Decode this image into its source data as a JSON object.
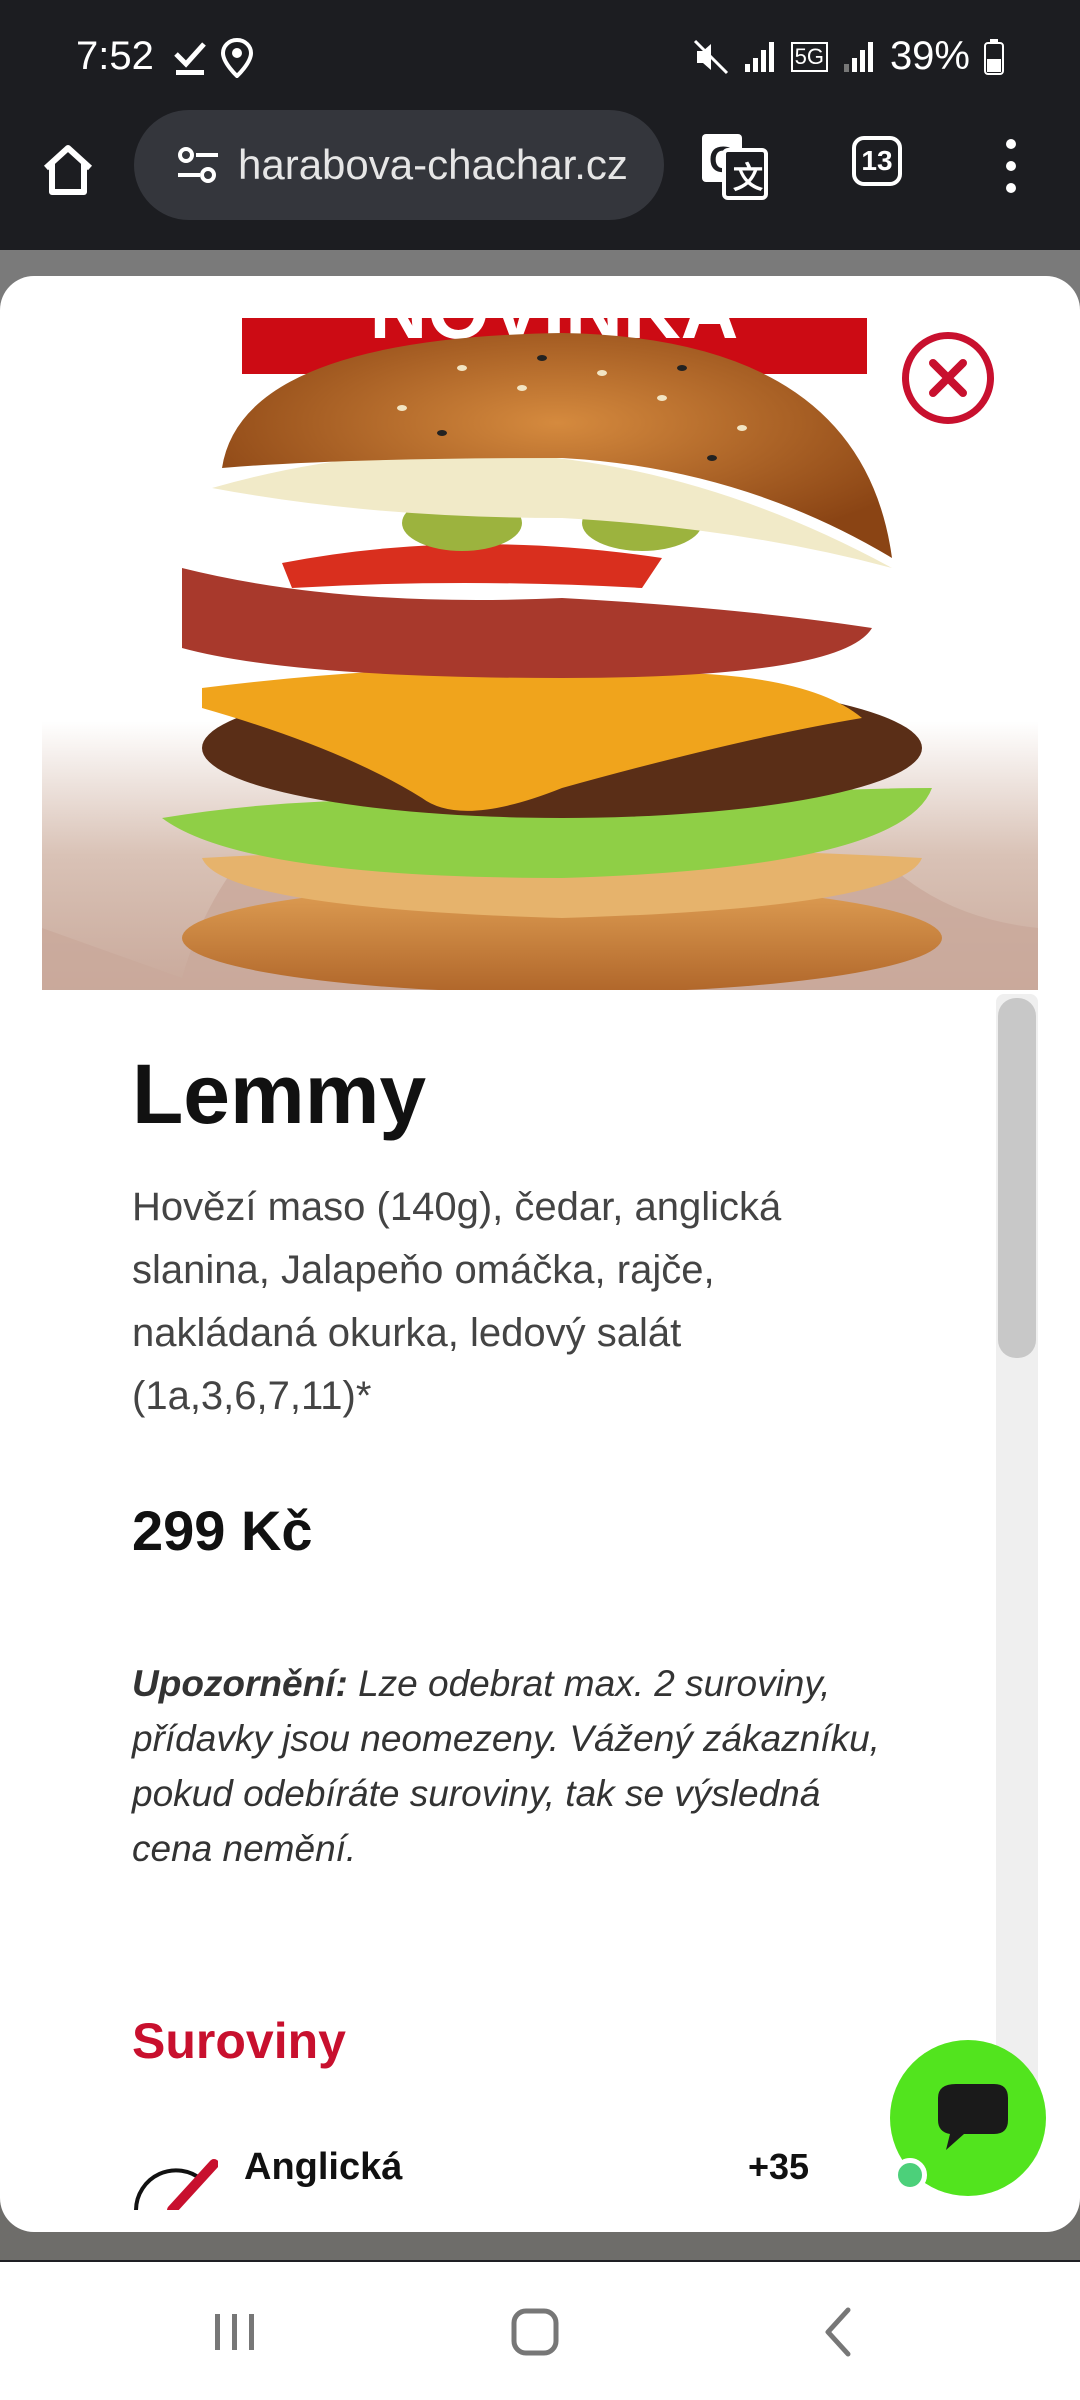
{
  "status_bar": {
    "time": "7:52",
    "network": "5G",
    "battery": "39%"
  },
  "browser": {
    "url": "harabova-chachar.cz",
    "tab_count": "13"
  },
  "product": {
    "title": "Lemmy",
    "description": "Hovězí maso (140g), čedar, anglická slanina, Jalapeňo omáčka, rajče, nakládaná okurka, ledový salát (1a,3,6,7,11)*",
    "price": "299 Kč",
    "banner_text": "NOVINKA",
    "notice_label": "Upozornění:",
    "notice_text": "Lze odebrat max. 2 suroviny, přídavky jsou neomezeny. Vážený zákazníku, pokud odebíráte suroviny, tak se výsledná cena nemění."
  },
  "ingredients": {
    "section_title": "Suroviny",
    "items": [
      {
        "name": "Anglická",
        "add_price": "+35"
      }
    ]
  },
  "colors": {
    "accent": "#c8102e",
    "chat": "#52e41e"
  }
}
